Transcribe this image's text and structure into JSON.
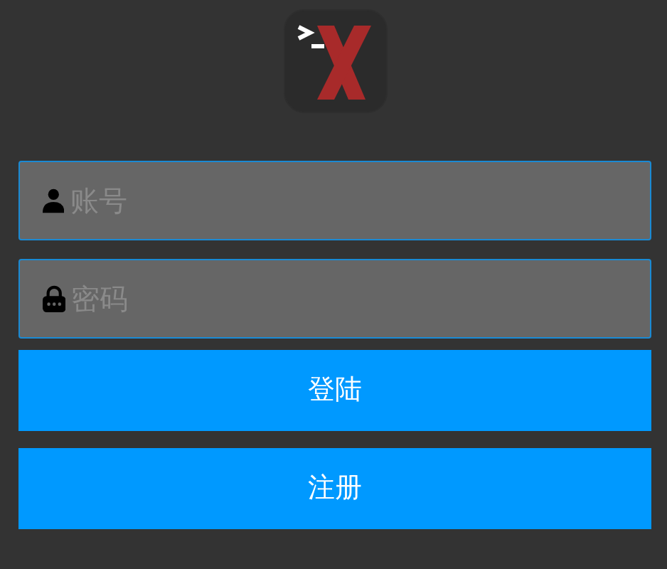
{
  "fields": [
    {
      "kind": "account",
      "placeholder": "账号"
    },
    {
      "kind": "password",
      "placeholder": "密码"
    }
  ],
  "buttons": [
    {
      "label": "登陆"
    },
    {
      "label": "注册"
    }
  ]
}
